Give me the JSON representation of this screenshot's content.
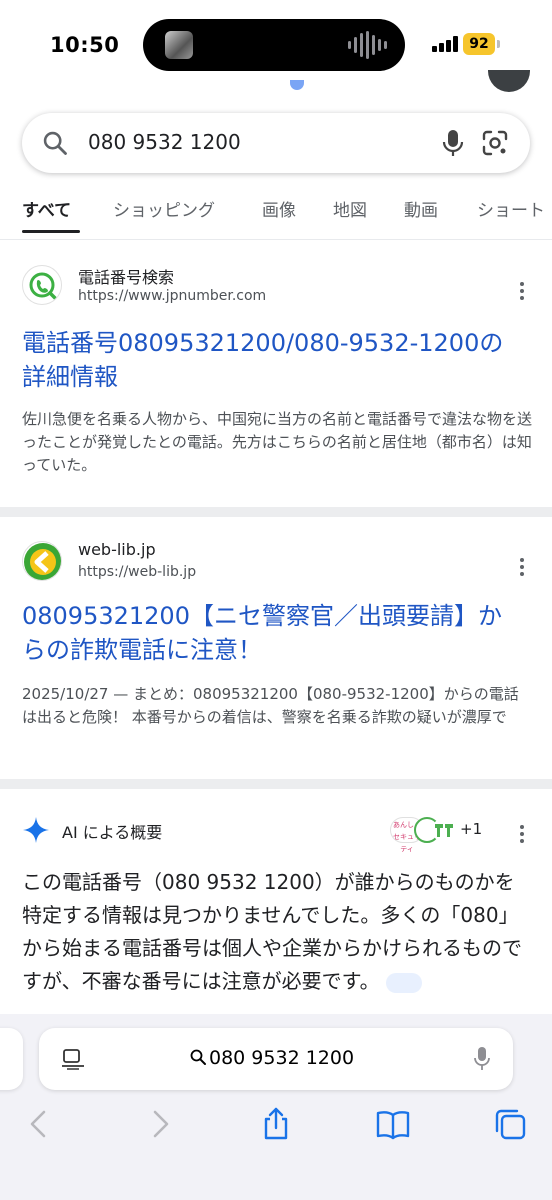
{
  "status": {
    "time": "10:50",
    "battery": "92"
  },
  "search": {
    "query": "080 9532 1200"
  },
  "tabs": [
    {
      "label": "すべて",
      "active": true
    },
    {
      "label": "ショッピング",
      "active": false
    },
    {
      "label": "画像",
      "active": false
    },
    {
      "label": "地図",
      "active": false
    },
    {
      "label": "動画",
      "active": false
    },
    {
      "label": "ショート",
      "active": false
    }
  ],
  "results": [
    {
      "site_name": "電話番号検索",
      "url": "https://www.jpnumber.com",
      "title": "電話番号08095321200/080-9532-1200の詳細情報",
      "snippet": "佐川急便を名乗る人物から、中国宛に当方の名前と電話番号で違法な物を送ったことが発覚したとの電話。先方はこちらの名前と居住地（都市名）は知っていた。"
    },
    {
      "site_name": "web-lib.jp",
      "url": "https://web-lib.jp",
      "title": "08095321200【ニセ警察官／出頭要請】からの詐欺電話に注意！",
      "snippet": "2025/10/27 — まとめ：08095321200【080-9532-1200】からの電話は出ると危険！ 本番号からの着信は、警察を名乗る詐欺の疑いが濃厚です。 着信拒否設定や対…"
    }
  ],
  "ai_overview": {
    "label": "AI による概要",
    "sources_more": "+1",
    "source_badge": "あんしんセキュリティ",
    "text": "この電話番号（080 9532 1200）が誰からのものかを特定する情報は見つかりませんでした。多くの「080」から始まる電話番号は個人や企業からかけられるものですが、不審な番号には注意が必要です。"
  },
  "safari": {
    "address": "080 9532 1200"
  },
  "colors": {
    "link": "#1f56c4",
    "battery": "#f6c52c",
    "ai_star": "#1a73e8"
  }
}
